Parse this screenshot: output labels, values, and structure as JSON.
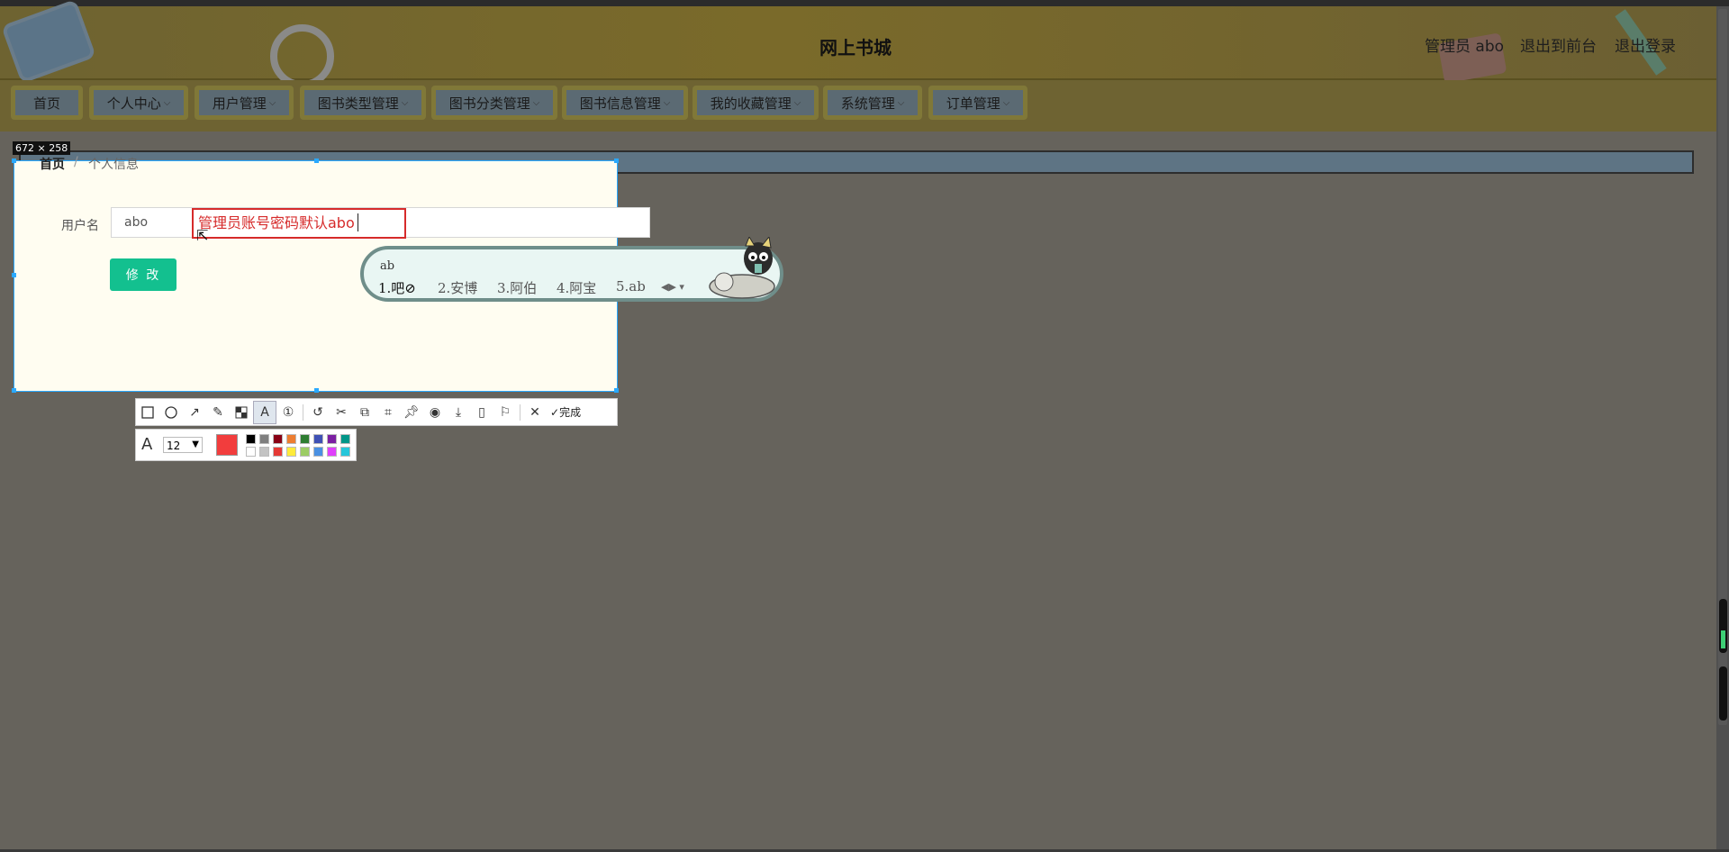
{
  "header": {
    "site_title": "网上书城",
    "user_label": "管理员 abo",
    "back_to_front": "退出到前台",
    "logout": "退出登录"
  },
  "nav": {
    "items": [
      {
        "label": "首页",
        "dropdown": false
      },
      {
        "label": "个人中心",
        "dropdown": true
      },
      {
        "label": "用户管理",
        "dropdown": true
      },
      {
        "label": "图书类型管理",
        "dropdown": true
      },
      {
        "label": "图书分类管理",
        "dropdown": true
      },
      {
        "label": "图书信息管理",
        "dropdown": true
      },
      {
        "label": "我的收藏管理",
        "dropdown": true
      },
      {
        "label": "系统管理",
        "dropdown": true
      },
      {
        "label": "订单管理",
        "dropdown": true
      }
    ],
    "chevron": "⌵"
  },
  "capture": {
    "size_label": "672 × 258"
  },
  "breadcrumb": {
    "home": "首页",
    "separator": "/",
    "current": "个人信息"
  },
  "form": {
    "username_label": "用户名",
    "username_value": "abo",
    "annotation_text": "管理员账号密码默认abo",
    "modify_button": "修 改"
  },
  "ime": {
    "input": "ab",
    "candidates": [
      "1.吧⊘",
      "2.安博",
      "3.阿伯",
      "4.阿宝",
      "5.ab"
    ],
    "arrows": "◀▶ ▾"
  },
  "screenshot_toolbar": {
    "tools": [
      "rectangle-icon",
      "ellipse-icon",
      "arrow-icon",
      "pencil-icon",
      "mosaic-icon",
      "text-icon",
      "number-icon",
      "undo-icon",
      "cut-icon",
      "translate-icon",
      "ocr-icon",
      "pin-icon",
      "record-icon",
      "save-icon",
      "phone-icon",
      "bookmark-icon",
      "close-icon"
    ],
    "done_label": "完成",
    "font_size": "12",
    "current_color": "#f23d3d",
    "palette": [
      "#000000",
      "#7f7f7f",
      "#880015",
      "#ed7d31",
      "#2e7d32",
      "#3f51b5",
      "#7b1fa2",
      "#009688",
      "#ffffff",
      "#c3c3c3",
      "#e53935",
      "#ffeb3b",
      "#9ccc65",
      "#4a90e2",
      "#e040fb",
      "#26c6da"
    ]
  },
  "colors": {
    "accent_green": "#13c08f",
    "annotation_red": "#d62b2b",
    "selection_blue": "#2aa9ff"
  }
}
